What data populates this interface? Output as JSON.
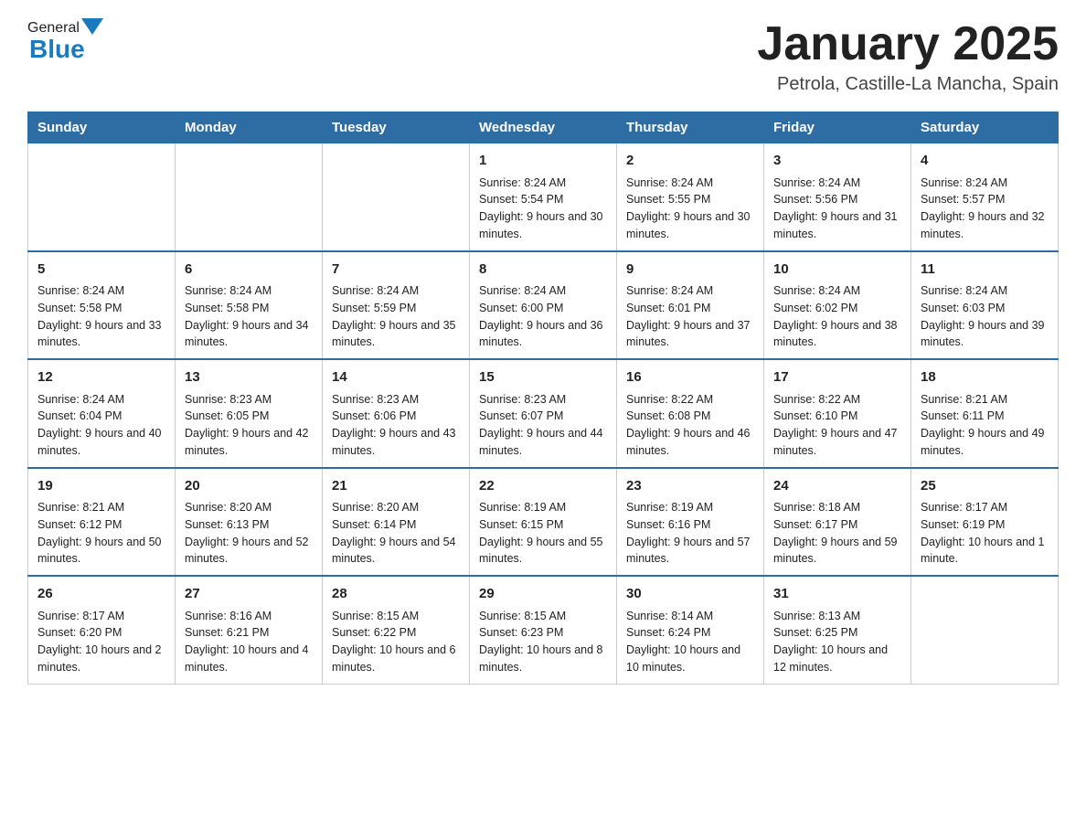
{
  "header": {
    "title": "January 2025",
    "location": "Petrola, Castille-La Mancha, Spain",
    "logo_general": "General",
    "logo_blue": "Blue"
  },
  "days_of_week": [
    "Sunday",
    "Monday",
    "Tuesday",
    "Wednesday",
    "Thursday",
    "Friday",
    "Saturday"
  ],
  "weeks": [
    [
      {
        "day": "",
        "info": ""
      },
      {
        "day": "",
        "info": ""
      },
      {
        "day": "",
        "info": ""
      },
      {
        "day": "1",
        "info": "Sunrise: 8:24 AM\nSunset: 5:54 PM\nDaylight: 9 hours and 30 minutes."
      },
      {
        "day": "2",
        "info": "Sunrise: 8:24 AM\nSunset: 5:55 PM\nDaylight: 9 hours and 30 minutes."
      },
      {
        "day": "3",
        "info": "Sunrise: 8:24 AM\nSunset: 5:56 PM\nDaylight: 9 hours and 31 minutes."
      },
      {
        "day": "4",
        "info": "Sunrise: 8:24 AM\nSunset: 5:57 PM\nDaylight: 9 hours and 32 minutes."
      }
    ],
    [
      {
        "day": "5",
        "info": "Sunrise: 8:24 AM\nSunset: 5:58 PM\nDaylight: 9 hours and 33 minutes."
      },
      {
        "day": "6",
        "info": "Sunrise: 8:24 AM\nSunset: 5:58 PM\nDaylight: 9 hours and 34 minutes."
      },
      {
        "day": "7",
        "info": "Sunrise: 8:24 AM\nSunset: 5:59 PM\nDaylight: 9 hours and 35 minutes."
      },
      {
        "day": "8",
        "info": "Sunrise: 8:24 AM\nSunset: 6:00 PM\nDaylight: 9 hours and 36 minutes."
      },
      {
        "day": "9",
        "info": "Sunrise: 8:24 AM\nSunset: 6:01 PM\nDaylight: 9 hours and 37 minutes."
      },
      {
        "day": "10",
        "info": "Sunrise: 8:24 AM\nSunset: 6:02 PM\nDaylight: 9 hours and 38 minutes."
      },
      {
        "day": "11",
        "info": "Sunrise: 8:24 AM\nSunset: 6:03 PM\nDaylight: 9 hours and 39 minutes."
      }
    ],
    [
      {
        "day": "12",
        "info": "Sunrise: 8:24 AM\nSunset: 6:04 PM\nDaylight: 9 hours and 40 minutes."
      },
      {
        "day": "13",
        "info": "Sunrise: 8:23 AM\nSunset: 6:05 PM\nDaylight: 9 hours and 42 minutes."
      },
      {
        "day": "14",
        "info": "Sunrise: 8:23 AM\nSunset: 6:06 PM\nDaylight: 9 hours and 43 minutes."
      },
      {
        "day": "15",
        "info": "Sunrise: 8:23 AM\nSunset: 6:07 PM\nDaylight: 9 hours and 44 minutes."
      },
      {
        "day": "16",
        "info": "Sunrise: 8:22 AM\nSunset: 6:08 PM\nDaylight: 9 hours and 46 minutes."
      },
      {
        "day": "17",
        "info": "Sunrise: 8:22 AM\nSunset: 6:10 PM\nDaylight: 9 hours and 47 minutes."
      },
      {
        "day": "18",
        "info": "Sunrise: 8:21 AM\nSunset: 6:11 PM\nDaylight: 9 hours and 49 minutes."
      }
    ],
    [
      {
        "day": "19",
        "info": "Sunrise: 8:21 AM\nSunset: 6:12 PM\nDaylight: 9 hours and 50 minutes."
      },
      {
        "day": "20",
        "info": "Sunrise: 8:20 AM\nSunset: 6:13 PM\nDaylight: 9 hours and 52 minutes."
      },
      {
        "day": "21",
        "info": "Sunrise: 8:20 AM\nSunset: 6:14 PM\nDaylight: 9 hours and 54 minutes."
      },
      {
        "day": "22",
        "info": "Sunrise: 8:19 AM\nSunset: 6:15 PM\nDaylight: 9 hours and 55 minutes."
      },
      {
        "day": "23",
        "info": "Sunrise: 8:19 AM\nSunset: 6:16 PM\nDaylight: 9 hours and 57 minutes."
      },
      {
        "day": "24",
        "info": "Sunrise: 8:18 AM\nSunset: 6:17 PM\nDaylight: 9 hours and 59 minutes."
      },
      {
        "day": "25",
        "info": "Sunrise: 8:17 AM\nSunset: 6:19 PM\nDaylight: 10 hours and 1 minute."
      }
    ],
    [
      {
        "day": "26",
        "info": "Sunrise: 8:17 AM\nSunset: 6:20 PM\nDaylight: 10 hours and 2 minutes."
      },
      {
        "day": "27",
        "info": "Sunrise: 8:16 AM\nSunset: 6:21 PM\nDaylight: 10 hours and 4 minutes."
      },
      {
        "day": "28",
        "info": "Sunrise: 8:15 AM\nSunset: 6:22 PM\nDaylight: 10 hours and 6 minutes."
      },
      {
        "day": "29",
        "info": "Sunrise: 8:15 AM\nSunset: 6:23 PM\nDaylight: 10 hours and 8 minutes."
      },
      {
        "day": "30",
        "info": "Sunrise: 8:14 AM\nSunset: 6:24 PM\nDaylight: 10 hours and 10 minutes."
      },
      {
        "day": "31",
        "info": "Sunrise: 8:13 AM\nSunset: 6:25 PM\nDaylight: 10 hours and 12 minutes."
      },
      {
        "day": "",
        "info": ""
      }
    ]
  ]
}
